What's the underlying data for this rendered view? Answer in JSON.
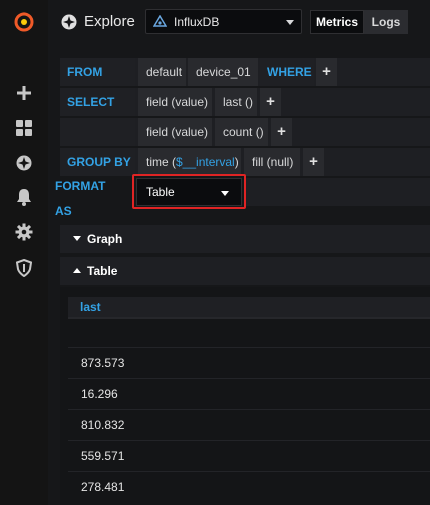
{
  "sidebar": {
    "icons": [
      "grafana-logo-icon",
      "plus-icon",
      "dashboards-icon",
      "explore-icon",
      "bell-icon",
      "gear-icon",
      "shield-icon"
    ]
  },
  "topbar": {
    "title": "Explore",
    "datasource": "InfluxDB",
    "mode_metrics": "Metrics",
    "mode_logs": "Logs"
  },
  "query": {
    "from_kw": "FROM",
    "from_policy": "default",
    "from_measurement": "device_01",
    "where_kw": "WHERE",
    "select_kw": "SELECT",
    "select1_field": "field (value)",
    "select1_fn": "last ()",
    "select2_field": "field (value)",
    "select2_fn": "count ()",
    "groupby_kw": "GROUP BY",
    "groupby_time_prefix": "time (",
    "groupby_time_var": "$__interval",
    "groupby_time_suffix": ")",
    "groupby_fill": "fill (null)",
    "format_kw": "FORMAT",
    "format_as_kw": "AS",
    "format_value": "Table",
    "plus": "+"
  },
  "panels": {
    "graph_label": "Graph",
    "table_label": "Table"
  },
  "table": {
    "column": "last",
    "rows": [
      "873.573",
      "16.296",
      "810.832",
      "559.571",
      "278.481"
    ]
  },
  "colors": {
    "keyword": "#33a2e5",
    "highlight": "#e02424",
    "background": "#161719"
  }
}
